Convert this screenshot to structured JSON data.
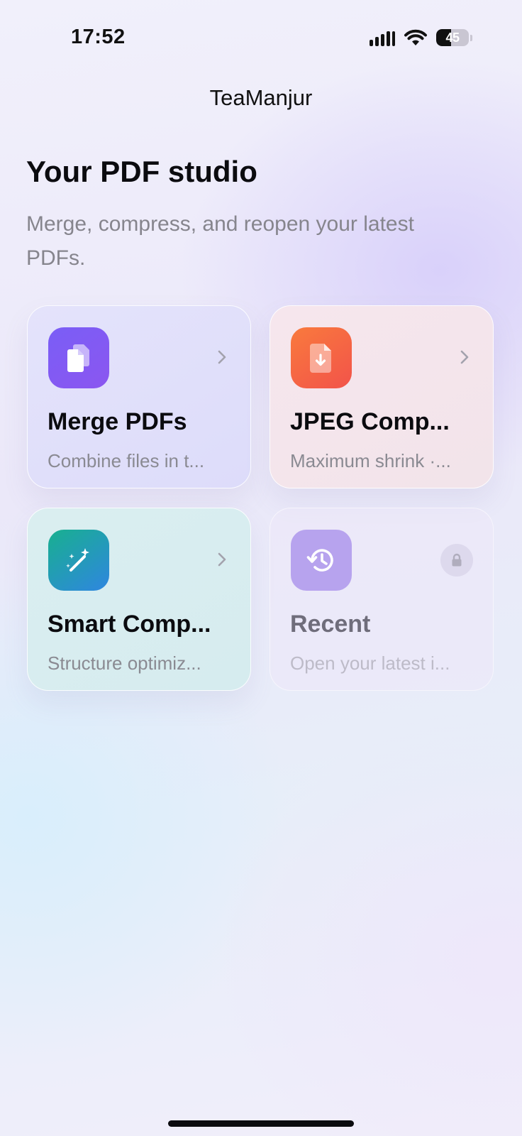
{
  "status_bar": {
    "time": "17:52",
    "battery_level": "45",
    "battery_fraction": 0.45,
    "icons": [
      "signal-icon",
      "wifi-icon",
      "battery-icon"
    ]
  },
  "header": {
    "app_title": "TeaManjur"
  },
  "main": {
    "title": "Your PDF studio",
    "subtitle": "Merge, compress, and reopen your latest PDFs."
  },
  "cards": [
    {
      "title": "Merge PDFs",
      "description": "Combine files in t...",
      "icon": "documents-icon",
      "accent": "#7a5ef6",
      "trailing": "chevron-right-icon"
    },
    {
      "title": "JPEG Comp...",
      "description": "Maximum shrink ·...",
      "icon": "file-download-icon",
      "accent": "#f5683f",
      "trailing": "chevron-right-icon"
    },
    {
      "title": "Smart Comp...",
      "description": "Structure optimiz...",
      "icon": "magic-wand-icon",
      "accent": "#1ea6a0",
      "trailing": "chevron-right-icon"
    },
    {
      "title": "Recent",
      "description": "Open your latest i...",
      "icon": "history-icon",
      "accent": "#b7a3ee",
      "trailing": "lock-icon",
      "locked": true
    }
  ]
}
